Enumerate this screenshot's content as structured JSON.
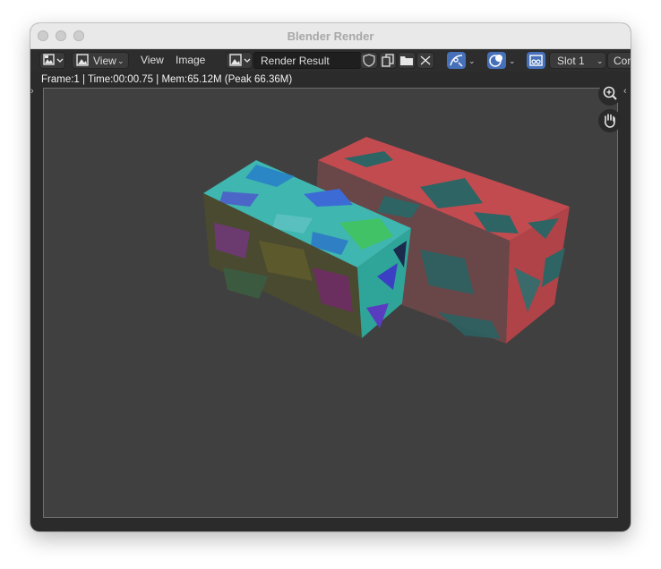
{
  "window": {
    "title": "Blender Render"
  },
  "toolbar": {
    "editor_type_icon": "image-editor-icon",
    "view_mode_label": "View",
    "menus": [
      "View",
      "Image"
    ],
    "image_browse_icon": "image-browse-icon",
    "image_name": "Render Result",
    "fake_user_icon": "shield-icon",
    "new_image_icon": "duplicate-icon",
    "open_image_icon": "folder-icon",
    "unlink_icon": "close-icon",
    "slot_label": "Slot 1",
    "composite_label": "Con"
  },
  "status": {
    "text": "Frame:1 | Time:00:00.75 | Mem:65.12M (Peak 66.36M)"
  },
  "viewport": {
    "zoom_icon": "zoom-icon",
    "pan_icon": "hand-icon",
    "background_color": "#404040"
  },
  "colors": {
    "accent": "#4670b9",
    "window_bg": "#2b2b2b",
    "red_cube": "#c04a4f",
    "teal": "#2d5f60"
  }
}
